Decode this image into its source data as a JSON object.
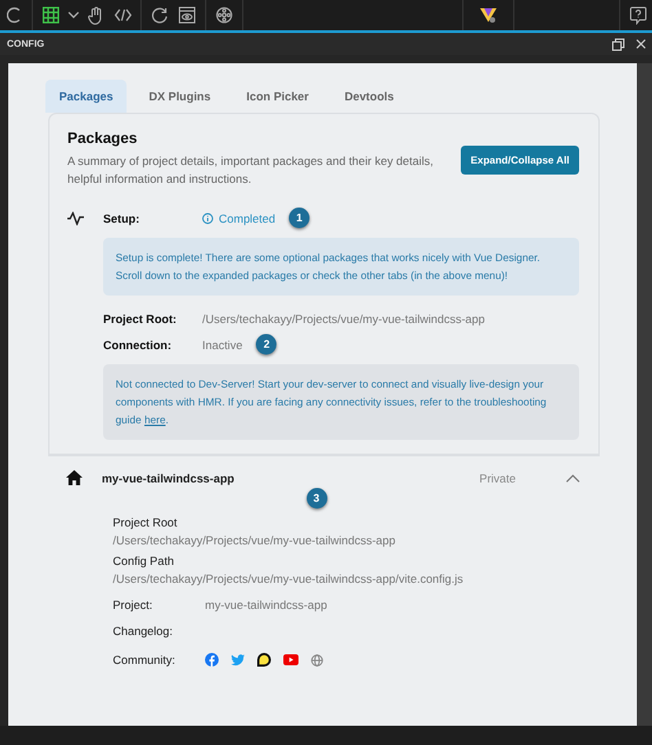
{
  "panel": {
    "title": "CONFIG"
  },
  "tabs": [
    {
      "label": "Packages",
      "selected": true
    },
    {
      "label": "DX Plugins",
      "selected": false
    },
    {
      "label": "Icon Picker",
      "selected": false
    },
    {
      "label": "Devtools",
      "selected": false
    }
  ],
  "summary": {
    "title": "Packages",
    "description": "A summary of project details, important packages and their key details, helpful information and instructions.",
    "button": "Expand/Collapse All"
  },
  "setup": {
    "label": "Setup:",
    "status": "Completed",
    "marker": "1",
    "note": "Setup is complete! There are some optional packages that works nicely with Vue Designer. Scroll down to the expanded packages or check the other tabs (in the above menu)!"
  },
  "project_root": {
    "label": "Project Root:",
    "value": "/Users/techakayy/Projects/vue/my-vue-tailwindcss-app"
  },
  "connection": {
    "label": "Connection:",
    "value": "Inactive",
    "marker": "2",
    "note": "Not connected to Dev-Server! Start your dev-server to connect and visually live-design your components with HMR. If you are facing any connectivity issues, refer to the troubleshooting guide ",
    "link": "here",
    "note_end": "."
  },
  "package": {
    "name": "my-vue-tailwindcss-app",
    "visibility": "Private",
    "expanded": true,
    "marker": "3",
    "paths": [
      {
        "label": "Project Root",
        "value": "/Users/techakayy/Projects/vue/my-vue-tailwindcss-app"
      },
      {
        "label": "Config Path",
        "value": "/Users/techakayy/Projects/vue/my-vue-tailwindcss-app/vite.config.js"
      }
    ],
    "fields": [
      {
        "label": "Project:",
        "value": "my-vue-tailwindcss-app"
      },
      {
        "label": "Changelog:"
      }
    ],
    "community": {
      "label": "Community:",
      "links": [
        {
          "kind": "facebook"
        },
        {
          "kind": "twitter"
        },
        {
          "kind": "chat"
        },
        {
          "kind": "video"
        },
        {
          "kind": "globe"
        }
      ]
    }
  }
}
